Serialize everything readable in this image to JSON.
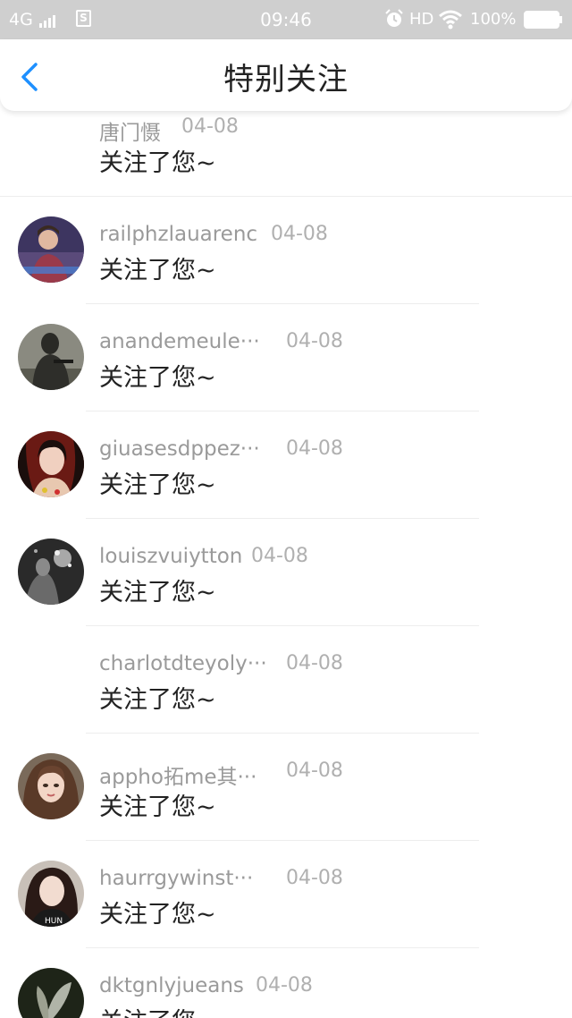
{
  "status_bar": {
    "network": "4G",
    "time": "09:46",
    "hd": "HD",
    "battery": "100%",
    "colors": {
      "background": "#cfcfcf",
      "foreground": "#ffffff"
    },
    "icons": [
      "signal-icon",
      "sim-icon",
      "alarm-icon",
      "wifi-icon",
      "battery-icon"
    ]
  },
  "nav": {
    "title": "特别关注",
    "back_icon": "chevron-left-icon",
    "back_color": "#1e90ff"
  },
  "items": [
    {
      "name": "唐门慑",
      "date": "04-08",
      "message": "关注了您~",
      "avatar": "none"
    },
    {
      "name": "railphzlauarenc",
      "date": "04-08",
      "message": "关注了您~",
      "avatar": "photo"
    },
    {
      "name": "anandemeule···",
      "date": "04-08",
      "message": "关注了您~",
      "avatar": "photo"
    },
    {
      "name": "giuasesdppez···",
      "date": "04-08",
      "message": "关注了您~",
      "avatar": "photo"
    },
    {
      "name": "louiszvuiytton",
      "date": "04-08",
      "message": "关注了您~",
      "avatar": "photo"
    },
    {
      "name": "charlotdteyoly···",
      "date": "04-08",
      "message": "关注了您~",
      "avatar": "none"
    },
    {
      "name": "appho拓me其···",
      "date": "04-08",
      "message": "关注了您~",
      "avatar": "photo"
    },
    {
      "name": "haurrgywinst···",
      "date": "04-08",
      "message": "关注了您~",
      "avatar": "photo"
    },
    {
      "name": "dktgnlyjueans",
      "date": "04-08",
      "message": "关注了您~",
      "avatar": "photo"
    }
  ]
}
